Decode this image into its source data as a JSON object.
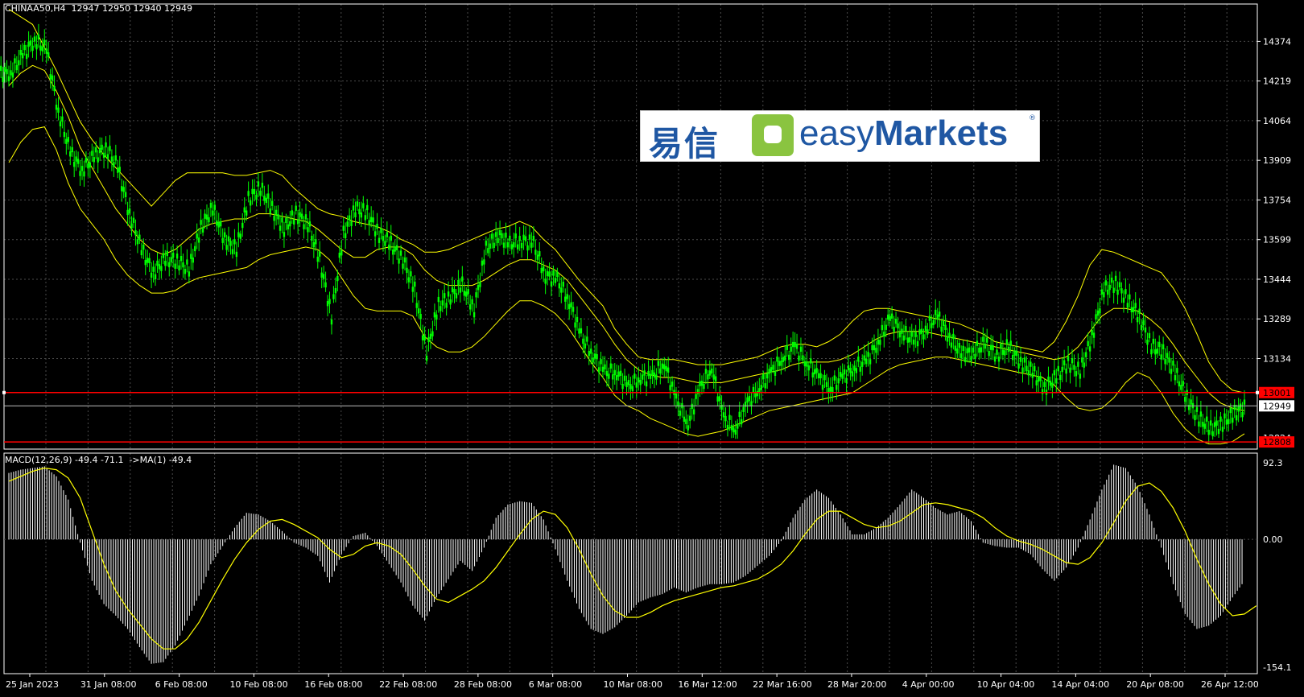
{
  "header": {
    "symbol_info": "CHINAA50,H4  12947 12950 12940 12949",
    "macd_info": "MACD(12,26,9) -49.4 -71.1  ->MA(1) -49.4"
  },
  "price_axis": {
    "labels": [
      "14374",
      "14219",
      "14064",
      "13909",
      "13754",
      "13599",
      "13444",
      "13289",
      "13134"
    ],
    "min_label": "12824",
    "current_price_label": "12949",
    "line_high_label": "13001",
    "line_low_label": "12808"
  },
  "macd_axis": {
    "labels": [
      "92.3",
      "0.00",
      "-154.1"
    ]
  },
  "time_axis": {
    "labels": [
      "25 Jan 2023",
      "31 Jan 08:00",
      "6 Feb 08:00",
      "10 Feb 08:00",
      "16 Feb 08:00",
      "22 Feb 08:00",
      "28 Feb 08:00",
      "6 Mar 08:00",
      "10 Mar 08:00",
      "16 Mar 12:00",
      "22 Mar 16:00",
      "28 Mar 20:00",
      "4 Apr 00:00",
      "10 Apr 04:00",
      "14 Apr 04:00",
      "20 Apr 08:00",
      "26 Apr 12:00"
    ]
  },
  "logo": {
    "cn": "易信",
    "en_light": "easy",
    "en_bold": "Markets",
    "reg": "®"
  },
  "colors": {
    "background": "#000000",
    "candle": "#00ff00",
    "bands": "#ffff00",
    "macd_hist": "#ffffff",
    "signal": "#ffff00",
    "level_line": "#ff0000",
    "grid": "#4a4a4a"
  },
  "chart_data": {
    "type": "line",
    "main": {
      "y_range": [
        12780,
        14520
      ],
      "close": [
        14250,
        14320,
        14380,
        14340,
        14100,
        13940,
        13870,
        13920,
        13960,
        13880,
        13700,
        13560,
        13470,
        13520,
        13520,
        13480,
        13650,
        13720,
        13600,
        13560,
        13760,
        13800,
        13720,
        13640,
        13700,
        13660,
        13520,
        13300,
        13620,
        13720,
        13700,
        13620,
        13580,
        13520,
        13400,
        13160,
        13340,
        13380,
        13420,
        13330,
        13560,
        13620,
        13580,
        13600,
        13580,
        13460,
        13440,
        13360,
        13220,
        13150,
        13080,
        13080,
        13020,
        13060,
        13060,
        13120,
        12970,
        12880,
        13020,
        13100,
        12900,
        12860,
        12960,
        13020,
        13080,
        13140,
        13180,
        13120,
        13060,
        13020,
        13060,
        13100,
        13120,
        13200,
        13290,
        13240,
        13200,
        13250,
        13300,
        13220,
        13150,
        13160,
        13190,
        13150,
        13180,
        13120,
        13080,
        13020,
        13060,
        13120,
        13080,
        13220,
        13400,
        13430,
        13360,
        13300,
        13180,
        13160,
        13080,
        12980,
        12900,
        12860,
        12880,
        12920,
        12949
      ],
      "upper_band": [
        14500,
        14470,
        14440,
        14350,
        14260,
        14160,
        14060,
        13990,
        13930,
        13880,
        13830,
        13780,
        13730,
        13780,
        13830,
        13860,
        13860,
        13860,
        13860,
        13850,
        13850,
        13860,
        13870,
        13850,
        13800,
        13760,
        13720,
        13700,
        13690,
        13670,
        13660,
        13650,
        13630,
        13600,
        13580,
        13550,
        13550,
        13560,
        13580,
        13600,
        13620,
        13640,
        13650,
        13670,
        13650,
        13600,
        13560,
        13500,
        13440,
        13390,
        13340,
        13250,
        13190,
        13140,
        13130,
        13130,
        13130,
        13120,
        13110,
        13110,
        13110,
        13120,
        13130,
        13140,
        13160,
        13180,
        13190,
        13190,
        13180,
        13200,
        13230,
        13280,
        13320,
        13330,
        13330,
        13320,
        13310,
        13300,
        13290,
        13280,
        13270,
        13250,
        13230,
        13200,
        13190,
        13180,
        13170,
        13160,
        13200,
        13280,
        13380,
        13500,
        13560,
        13550,
        13530,
        13510,
        13490,
        13470,
        13410,
        13330,
        13230,
        13120,
        13050,
        13010,
        13000
      ],
      "middle_band": [
        14200,
        14250,
        14280,
        14260,
        14180,
        14080,
        13960,
        13880,
        13800,
        13720,
        13660,
        13600,
        13560,
        13540,
        13560,
        13600,
        13640,
        13660,
        13670,
        13680,
        13680,
        13700,
        13700,
        13690,
        13680,
        13670,
        13640,
        13600,
        13560,
        13530,
        13530,
        13560,
        13570,
        13570,
        13540,
        13480,
        13440,
        13420,
        13420,
        13420,
        13440,
        13470,
        13500,
        13520,
        13520,
        13500,
        13480,
        13440,
        13380,
        13320,
        13260,
        13190,
        13130,
        13090,
        13070,
        13060,
        13060,
        13050,
        13040,
        13040,
        13040,
        13050,
        13060,
        13070,
        13080,
        13090,
        13110,
        13120,
        13120,
        13120,
        13130,
        13150,
        13180,
        13210,
        13230,
        13240,
        13240,
        13240,
        13230,
        13220,
        13210,
        13200,
        13190,
        13180,
        13170,
        13160,
        13150,
        13140,
        13130,
        13140,
        13180,
        13240,
        13300,
        13330,
        13330,
        13320,
        13290,
        13250,
        13190,
        13120,
        13060,
        13000,
        12960,
        12940,
        12930
      ],
      "lower_band": [
        13900,
        13980,
        14030,
        14040,
        13950,
        13820,
        13720,
        13660,
        13600,
        13520,
        13460,
        13420,
        13390,
        13390,
        13400,
        13430,
        13450,
        13460,
        13470,
        13480,
        13490,
        13520,
        13540,
        13550,
        13560,
        13570,
        13560,
        13520,
        13450,
        13380,
        13330,
        13320,
        13320,
        13320,
        13300,
        13220,
        13180,
        13160,
        13160,
        13180,
        13220,
        13270,
        13320,
        13360,
        13360,
        13340,
        13310,
        13260,
        13190,
        13120,
        13060,
        12990,
        12950,
        12930,
        12900,
        12880,
        12860,
        12840,
        12830,
        12840,
        12850,
        12870,
        12890,
        12910,
        12930,
        12940,
        12950,
        12960,
        12970,
        12980,
        12990,
        13000,
        13030,
        13060,
        13090,
        13110,
        13120,
        13130,
        13140,
        13140,
        13130,
        13120,
        13110,
        13100,
        13090,
        13080,
        13070,
        13060,
        13030,
        12980,
        12940,
        12930,
        12940,
        12980,
        13040,
        13080,
        13060,
        13000,
        12920,
        12860,
        12820,
        12800,
        12800,
        12810,
        12840
      ],
      "level_high": 13001,
      "level_low": 12808,
      "current": 12949
    },
    "macd": {
      "y_range": [
        -154.1,
        92.3
      ],
      "histogram": [
        80,
        84,
        86,
        88,
        76,
        48,
        -4,
        -50,
        -78,
        -92,
        -108,
        -130,
        -150,
        -148,
        -128,
        -98,
        -68,
        -30,
        -8,
        14,
        32,
        30,
        22,
        10,
        -4,
        -10,
        -20,
        -52,
        -18,
        4,
        8,
        -8,
        -30,
        -52,
        -80,
        -98,
        -70,
        -48,
        -26,
        -38,
        -10,
        26,
        42,
        46,
        44,
        24,
        -12,
        -50,
        -84,
        -108,
        -114,
        -106,
        -92,
        -76,
        -70,
        -66,
        -58,
        -64,
        -58,
        -54,
        -54,
        -52,
        -44,
        -32,
        -20,
        -2,
        26,
        48,
        60,
        50,
        30,
        6,
        6,
        14,
        26,
        42,
        60,
        50,
        38,
        30,
        34,
        22,
        -4,
        -8,
        -10,
        -10,
        -18,
        -36,
        -50,
        -34,
        -10,
        24,
        60,
        90,
        86,
        64,
        30,
        -10,
        -54,
        -90,
        -108,
        -104,
        -92,
        -70,
        -50
      ],
      "signal": [
        70,
        76,
        82,
        86,
        84,
        74,
        50,
        10,
        -30,
        -62,
        -84,
        -102,
        -120,
        -132,
        -132,
        -120,
        -100,
        -74,
        -48,
        -24,
        -4,
        12,
        22,
        24,
        18,
        10,
        2,
        -12,
        -22,
        -18,
        -8,
        -4,
        -8,
        -18,
        -36,
        -56,
        -72,
        -76,
        -68,
        -60,
        -50,
        -34,
        -14,
        6,
        24,
        34,
        30,
        14,
        -12,
        -42,
        -68,
        -86,
        -94,
        -94,
        -88,
        -80,
        -74,
        -70,
        -66,
        -62,
        -58,
        -56,
        -52,
        -48,
        -40,
        -30,
        -14,
        6,
        24,
        34,
        34,
        26,
        18,
        14,
        16,
        22,
        32,
        42,
        44,
        42,
        38,
        34,
        26,
        14,
        4,
        -2,
        -6,
        -12,
        -20,
        -28,
        -30,
        -22,
        -4,
        20,
        46,
        64,
        68,
        58,
        38,
        10,
        -24,
        -54,
        -78,
        -92,
        -90,
        -80
      ],
      "x_count": 105
    }
  }
}
